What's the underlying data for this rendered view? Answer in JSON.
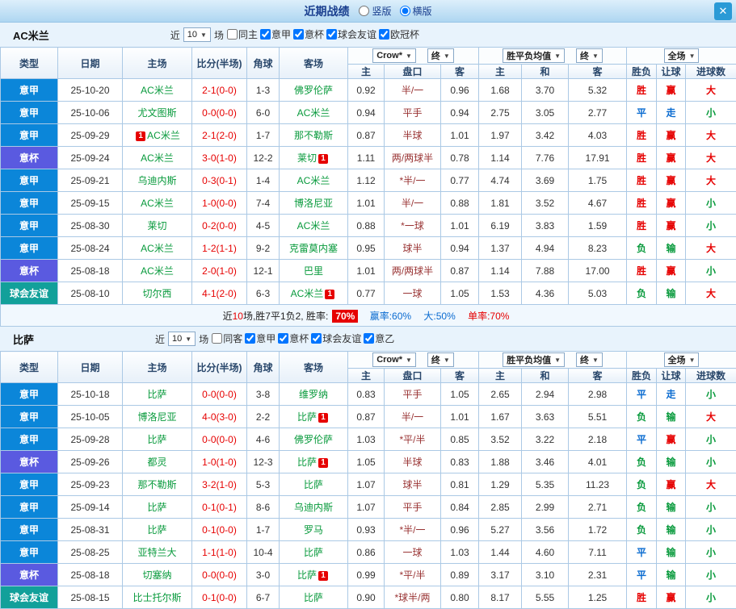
{
  "ui": {
    "arrow": "▼"
  },
  "topbar": {
    "title": "近期战绩",
    "radio_vertical": "竖版",
    "radio_horizontal": "横版",
    "close": "✕"
  },
  "maps": {
    "league_bg": {
      "意甲": "#0b86d9",
      "意杯": "#5a5ae0",
      "球会友谊": "#12a09a"
    },
    "outcome": {
      "胜": "#e60000",
      "平": "#0a6bd0",
      "负": "#089a3c",
      "赢": "#e60000",
      "走": "#0a6bd0",
      "输": "#089a3c",
      "大": "#e60000",
      "小": "#089a3c"
    }
  },
  "sections": [
    {
      "title": "AC米兰",
      "controls": {
        "near": "近",
        "matches": "10",
        "suffix": "场",
        "checkboxes": [
          {
            "label": "同主",
            "checked": false
          },
          {
            "label": "意甲",
            "checked": true
          },
          {
            "label": "意杯",
            "checked": true
          },
          {
            "label": "球会友谊",
            "checked": true
          },
          {
            "label": "欧冠杯",
            "checked": true
          }
        ]
      },
      "header": {
        "cols": [
          "类型",
          "日期",
          "主场",
          "比分(半场)",
          "角球",
          "客场"
        ],
        "odds_company": "Crow*",
        "final1": "终",
        "wdl": "胜平负均值",
        "final2": "终",
        "full": "全场",
        "sub": [
          "主",
          "盘口",
          "客",
          "主",
          "和",
          "客",
          "胜负",
          "让球",
          "进球数"
        ]
      },
      "rows": [
        {
          "league": "意甲",
          "date": "25-10-20",
          "home": "AC米兰",
          "hb": "",
          "score": "2-1(0-0)",
          "corner": "1-3",
          "away": "佛罗伦萨",
          "ab": "",
          "h": "0.92",
          "hcap": "半/一",
          "a": "0.96",
          "w": "1.68",
          "d": "3.70",
          "l": "5.32",
          "r": "胜",
          "hr": "赢",
          "g": "大"
        },
        {
          "league": "意甲",
          "date": "25-10-06",
          "home": "尤文图斯",
          "hb": "",
          "score": "0-0(0-0)",
          "corner": "6-0",
          "away": "AC米兰",
          "ab": "",
          "h": "0.94",
          "hcap": "平手",
          "a": "0.94",
          "w": "2.75",
          "d": "3.05",
          "l": "2.77",
          "r": "平",
          "hr": "走",
          "g": "小"
        },
        {
          "league": "意甲",
          "date": "25-09-29",
          "home": "AC米兰",
          "hb": "1",
          "score": "2-1(2-0)",
          "corner": "1-7",
          "away": "那不勒斯",
          "ab": "",
          "h": "0.87",
          "hcap": "半球",
          "a": "1.01",
          "w": "1.97",
          "d": "3.42",
          "l": "4.03",
          "r": "胜",
          "hr": "赢",
          "g": "大"
        },
        {
          "league": "意杯",
          "date": "25-09-24",
          "home": "AC米兰",
          "hb": "",
          "score": "3-0(1-0)",
          "corner": "12-2",
          "away": "莱切",
          "ab": "1",
          "h": "1.11",
          "hcap": "两/两球半",
          "a": "0.78",
          "w": "1.14",
          "d": "7.76",
          "l": "17.91",
          "r": "胜",
          "hr": "赢",
          "g": "大"
        },
        {
          "league": "意甲",
          "date": "25-09-21",
          "home": "乌迪内斯",
          "hb": "",
          "score": "0-3(0-1)",
          "corner": "1-4",
          "away": "AC米兰",
          "ab": "",
          "h": "1.12",
          "hcap": "*半/一",
          "a": "0.77",
          "w": "4.74",
          "d": "3.69",
          "l": "1.75",
          "r": "胜",
          "hr": "赢",
          "g": "大"
        },
        {
          "league": "意甲",
          "date": "25-09-15",
          "home": "AC米兰",
          "hb": "",
          "score": "1-0(0-0)",
          "corner": "7-4",
          "away": "博洛尼亚",
          "ab": "",
          "h": "1.01",
          "hcap": "半/一",
          "a": "0.88",
          "w": "1.81",
          "d": "3.52",
          "l": "4.67",
          "r": "胜",
          "hr": "赢",
          "g": "小"
        },
        {
          "league": "意甲",
          "date": "25-08-30",
          "home": "莱切",
          "hb": "",
          "score": "0-2(0-0)",
          "corner": "4-5",
          "away": "AC米兰",
          "ab": "",
          "h": "0.88",
          "hcap": "*一球",
          "a": "1.01",
          "w": "6.19",
          "d": "3.83",
          "l": "1.59",
          "r": "胜",
          "hr": "赢",
          "g": "小"
        },
        {
          "league": "意甲",
          "date": "25-08-24",
          "home": "AC米兰",
          "hb": "",
          "score": "1-2(1-1)",
          "corner": "9-2",
          "away": "克雷莫内塞",
          "ab": "",
          "h": "0.95",
          "hcap": "球半",
          "a": "0.94",
          "w": "1.37",
          "d": "4.94",
          "l": "8.23",
          "r": "负",
          "hr": "输",
          "g": "大"
        },
        {
          "league": "意杯",
          "date": "25-08-18",
          "home": "AC米兰",
          "hb": "",
          "score": "2-0(1-0)",
          "corner": "12-1",
          "away": "巴里",
          "ab": "",
          "h": "1.01",
          "hcap": "两/两球半",
          "a": "0.87",
          "w": "1.14",
          "d": "7.88",
          "l": "17.00",
          "r": "胜",
          "hr": "赢",
          "g": "小"
        },
        {
          "league": "球会友谊",
          "date": "25-08-10",
          "home": "切尔西",
          "hb": "",
          "score": "4-1(2-0)",
          "corner": "6-3",
          "away": "AC米兰",
          "ab": "1",
          "h": "0.77",
          "hcap": "一球",
          "a": "1.05",
          "w": "1.53",
          "d": "4.36",
          "l": "5.03",
          "r": "负",
          "hr": "输",
          "g": "大"
        }
      ],
      "summary": {
        "pre": "近",
        "num": "10",
        "mid": "场,胜7平1负2, 胜率:",
        "rate": "70%",
        "win": "赢率:60%",
        "big": "大:50%",
        "single": "单率:70%"
      }
    },
    {
      "title": "比萨",
      "controls": {
        "near": "近",
        "matches": "10",
        "suffix": "场",
        "checkboxes": [
          {
            "label": "同客",
            "checked": false
          },
          {
            "label": "意甲",
            "checked": true
          },
          {
            "label": "意杯",
            "checked": true
          },
          {
            "label": "球会友谊",
            "checked": true
          },
          {
            "label": "意乙",
            "checked": true
          }
        ]
      },
      "header": {
        "cols": [
          "类型",
          "日期",
          "主场",
          "比分(半场)",
          "角球",
          "客场"
        ],
        "odds_company": "Crow*",
        "final1": "终",
        "wdl": "胜平负均值",
        "final2": "终",
        "full": "全场",
        "sub": [
          "主",
          "盘口",
          "客",
          "主",
          "和",
          "客",
          "胜负",
          "让球",
          "进球数"
        ]
      },
      "rows": [
        {
          "league": "意甲",
          "date": "25-10-18",
          "home": "比萨",
          "hb": "",
          "score": "0-0(0-0)",
          "corner": "3-8",
          "away": "维罗纳",
          "ab": "",
          "h": "0.83",
          "hcap": "平手",
          "a": "1.05",
          "w": "2.65",
          "d": "2.94",
          "l": "2.98",
          "r": "平",
          "hr": "走",
          "g": "小"
        },
        {
          "league": "意甲",
          "date": "25-10-05",
          "home": "博洛尼亚",
          "hb": "",
          "score": "4-0(3-0)",
          "corner": "2-2",
          "away": "比萨",
          "ab": "1",
          "h": "0.87",
          "hcap": "半/一",
          "a": "1.01",
          "w": "1.67",
          "d": "3.63",
          "l": "5.51",
          "r": "负",
          "hr": "输",
          "g": "大"
        },
        {
          "league": "意甲",
          "date": "25-09-28",
          "home": "比萨",
          "hb": "",
          "score": "0-0(0-0)",
          "corner": "4-6",
          "away": "佛罗伦萨",
          "ab": "",
          "h": "1.03",
          "hcap": "*平/半",
          "a": "0.85",
          "w": "3.52",
          "d": "3.22",
          "l": "2.18",
          "r": "平",
          "hr": "赢",
          "g": "小"
        },
        {
          "league": "意杯",
          "date": "25-09-26",
          "home": "都灵",
          "hb": "",
          "score": "1-0(1-0)",
          "corner": "12-3",
          "away": "比萨",
          "ab": "1",
          "h": "1.05",
          "hcap": "半球",
          "a": "0.83",
          "w": "1.88",
          "d": "3.46",
          "l": "4.01",
          "r": "负",
          "hr": "输",
          "g": "小"
        },
        {
          "league": "意甲",
          "date": "25-09-23",
          "home": "那不勒斯",
          "hb": "",
          "score": "3-2(1-0)",
          "corner": "5-3",
          "away": "比萨",
          "ab": "",
          "h": "1.07",
          "hcap": "球半",
          "a": "0.81",
          "w": "1.29",
          "d": "5.35",
          "l": "11.23",
          "r": "负",
          "hr": "赢",
          "g": "大"
        },
        {
          "league": "意甲",
          "date": "25-09-14",
          "home": "比萨",
          "hb": "",
          "score": "0-1(0-1)",
          "corner": "8-6",
          "away": "乌迪内斯",
          "ab": "",
          "h": "1.07",
          "hcap": "平手",
          "a": "0.84",
          "w": "2.85",
          "d": "2.99",
          "l": "2.71",
          "r": "负",
          "hr": "输",
          "g": "小"
        },
        {
          "league": "意甲",
          "date": "25-08-31",
          "home": "比萨",
          "hb": "",
          "score": "0-1(0-0)",
          "corner": "1-7",
          "away": "罗马",
          "ab": "",
          "h": "0.93",
          "hcap": "*半/一",
          "a": "0.96",
          "w": "5.27",
          "d": "3.56",
          "l": "1.72",
          "r": "负",
          "hr": "输",
          "g": "小"
        },
        {
          "league": "意甲",
          "date": "25-08-25",
          "home": "亚特兰大",
          "hb": "",
          "score": "1-1(1-0)",
          "corner": "10-4",
          "away": "比萨",
          "ab": "",
          "h": "0.86",
          "hcap": "一球",
          "a": "1.03",
          "w": "1.44",
          "d": "4.60",
          "l": "7.11",
          "r": "平",
          "hr": "输",
          "g": "小"
        },
        {
          "league": "意杯",
          "date": "25-08-18",
          "home": "切塞纳",
          "hb": "",
          "score": "0-0(0-0)",
          "corner": "3-0",
          "away": "比萨",
          "ab": "1",
          "h": "0.99",
          "hcap": "*平/半",
          "a": "0.89",
          "w": "3.17",
          "d": "3.10",
          "l": "2.31",
          "r": "平",
          "hr": "输",
          "g": "小"
        },
        {
          "league": "球会友谊",
          "date": "25-08-15",
          "home": "比士托尔斯",
          "hb": "",
          "score": "0-1(0-0)",
          "corner": "6-7",
          "away": "比萨",
          "ab": "",
          "h": "0.90",
          "hcap": "*球半/两",
          "a": "0.80",
          "w": "8.17",
          "d": "5.55",
          "l": "1.25",
          "r": "胜",
          "hr": "赢",
          "g": "小"
        }
      ]
    }
  ]
}
